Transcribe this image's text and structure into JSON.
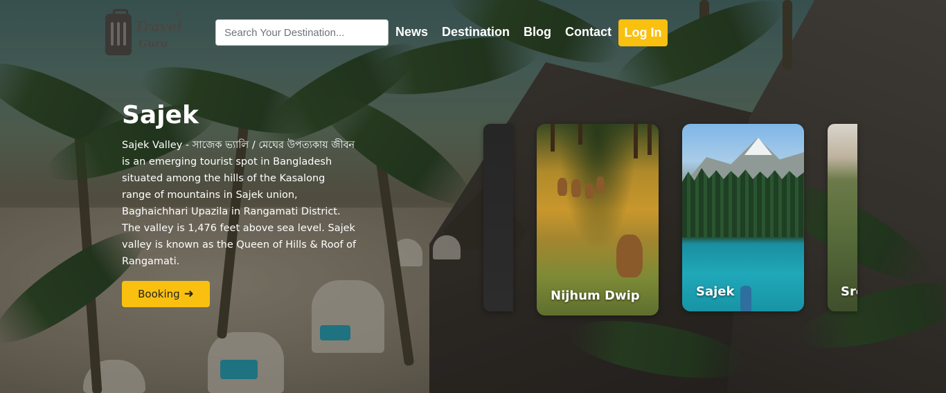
{
  "header": {
    "logo": {
      "line1": "Travel",
      "line2": "Guru"
    },
    "search": {
      "placeholder": "Search Your Destination..."
    },
    "nav": [
      "News",
      "Destination",
      "Blog",
      "Contact"
    ],
    "login_label": "Log In"
  },
  "hero": {
    "title": "Sajek",
    "description": "Sajek Valley - সাজেক ভ্যালি / মেঘের উপত্যকায় জীবন is an emerging tourist spot in Bangladesh situated among the hills of the Kasalong range of mountains in Sajek union, Baghaichhari Upazila in Rangamati District. The valley is 1,476 feet above sea level. Sajek valley is known as the Queen of Hills & Roof of Rangamati.",
    "booking_label": "Booking",
    "booking_icon": "arrow-right-icon"
  },
  "carousel": {
    "cards": [
      {
        "label": "Nijhum Dwip"
      },
      {
        "label": "Sajek"
      },
      {
        "label": "Sre"
      }
    ]
  },
  "colors": {
    "accent": "#f9c010",
    "text": "#ffffff"
  }
}
